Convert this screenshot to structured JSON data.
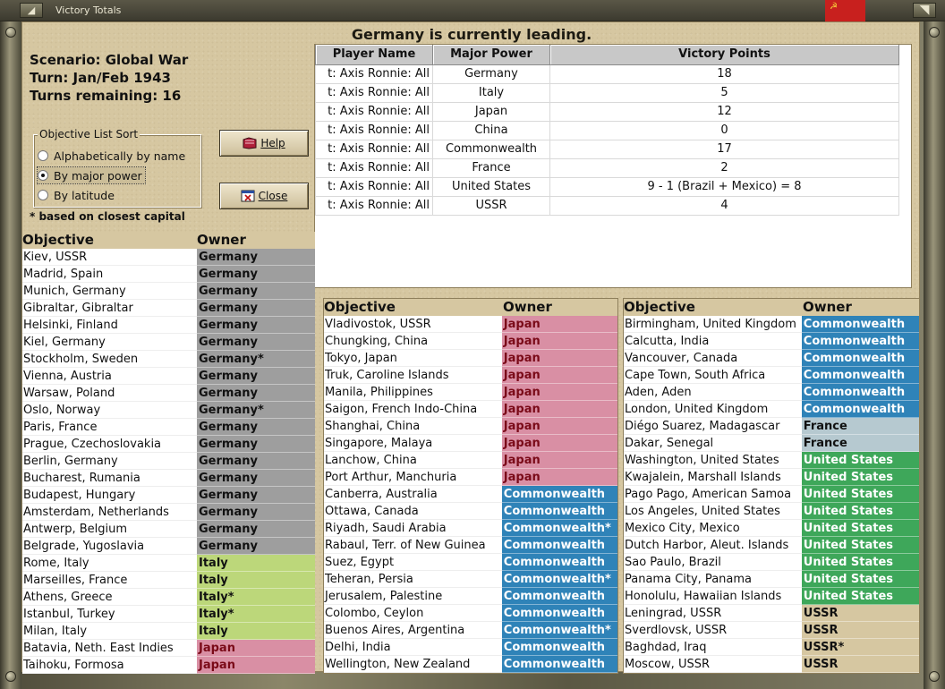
{
  "window": {
    "title": "Victory Totals"
  },
  "colors": {
    "germany": "#9e9e9e",
    "italy": "#bcd77a",
    "japan": "#d98fa4",
    "commonwealth": "#2f83b8",
    "france": "#b6c9d0",
    "united_states": "#3ea75a",
    "ussr": "#d6c7a1",
    "parchment": "#d6c7a1"
  },
  "banner": "Germany is currently leading.",
  "scenario": {
    "scenario_line": "Scenario: Global War",
    "turn_line": "Turn: Jan/Feb 1943",
    "remaining_line": "Turns remaining: 16"
  },
  "sort": {
    "legend": "Objective List Sort",
    "options": [
      "Alphabetically by name",
      "By major power",
      "By latitude"
    ],
    "selected_index": 1,
    "footnote": "* based on closest capital"
  },
  "buttons": {
    "help": "Help",
    "close": "Close"
  },
  "vp_table": {
    "headers": [
      "Player Name",
      "Major Power",
      "Victory Points"
    ],
    "rows": [
      {
        "player": "t: Axis    Ronnie: All",
        "power": "Germany",
        "points": "18"
      },
      {
        "player": "t: Axis    Ronnie: All",
        "power": "Italy",
        "points": "5"
      },
      {
        "player": "t: Axis    Ronnie: All",
        "power": "Japan",
        "points": "12"
      },
      {
        "player": "t: Axis    Ronnie: All",
        "power": "China",
        "points": "0"
      },
      {
        "player": "t: Axis    Ronnie: All",
        "power": "Commonwealth",
        "points": "17"
      },
      {
        "player": "t: Axis    Ronnie: All",
        "power": "France",
        "points": "2"
      },
      {
        "player": "t: Axis    Ronnie: All",
        "power": "United States",
        "points": "9 - 1 (Brazil + Mexico) = 8"
      },
      {
        "player": "t: Axis    Ronnie: All",
        "power": "USSR",
        "points": "4"
      }
    ]
  },
  "objective_headers": {
    "objective": "Objective",
    "owner": "Owner"
  },
  "lists": {
    "left": [
      {
        "name": "Kiev, USSR",
        "owner": "Germany",
        "power": "germany"
      },
      {
        "name": "Madrid, Spain",
        "owner": "Germany",
        "power": "germany"
      },
      {
        "name": "Munich, Germany",
        "owner": "Germany",
        "power": "germany"
      },
      {
        "name": "Gibraltar, Gibraltar",
        "owner": "Germany",
        "power": "germany"
      },
      {
        "name": "Helsinki, Finland",
        "owner": "Germany",
        "power": "germany"
      },
      {
        "name": "Kiel, Germany",
        "owner": "Germany",
        "power": "germany"
      },
      {
        "name": "Stockholm, Sweden",
        "owner": "Germany*",
        "power": "germany"
      },
      {
        "name": "Vienna, Austria",
        "owner": "Germany",
        "power": "germany"
      },
      {
        "name": "Warsaw, Poland",
        "owner": "Germany",
        "power": "germany"
      },
      {
        "name": "Oslo, Norway",
        "owner": "Germany*",
        "power": "germany"
      },
      {
        "name": "Paris, France",
        "owner": "Germany",
        "power": "germany"
      },
      {
        "name": "Prague, Czechoslovakia",
        "owner": "Germany",
        "power": "germany"
      },
      {
        "name": "Berlin, Germany",
        "owner": "Germany",
        "power": "germany"
      },
      {
        "name": "Bucharest, Rumania",
        "owner": "Germany",
        "power": "germany"
      },
      {
        "name": "Budapest, Hungary",
        "owner": "Germany",
        "power": "germany"
      },
      {
        "name": "Amsterdam, Netherlands",
        "owner": "Germany",
        "power": "germany"
      },
      {
        "name": "Antwerp, Belgium",
        "owner": "Germany",
        "power": "germany"
      },
      {
        "name": "Belgrade, Yugoslavia",
        "owner": "Germany",
        "power": "germany"
      },
      {
        "name": "Rome, Italy",
        "owner": "Italy",
        "power": "italy"
      },
      {
        "name": "Marseilles, France",
        "owner": "Italy",
        "power": "italy"
      },
      {
        "name": "Athens, Greece",
        "owner": "Italy*",
        "power": "italy"
      },
      {
        "name": "Istanbul, Turkey",
        "owner": "Italy*",
        "power": "italy"
      },
      {
        "name": "Milan, Italy",
        "owner": "Italy",
        "power": "italy"
      },
      {
        "name": "Batavia, Neth. East Indies",
        "owner": "Japan",
        "power": "japan"
      },
      {
        "name": "Taihoku, Formosa",
        "owner": "Japan",
        "power": "japan"
      }
    ],
    "middle": [
      {
        "name": "Vladivostok, USSR",
        "owner": "Japan",
        "power": "japan"
      },
      {
        "name": "Chungking, China",
        "owner": "Japan",
        "power": "japan"
      },
      {
        "name": "Tokyo, Japan",
        "owner": "Japan",
        "power": "japan"
      },
      {
        "name": "Truk, Caroline Islands",
        "owner": "Japan",
        "power": "japan"
      },
      {
        "name": "Manila, Philippines",
        "owner": "Japan",
        "power": "japan"
      },
      {
        "name": "Saigon, French Indo-China",
        "owner": "Japan",
        "power": "japan"
      },
      {
        "name": "Shanghai, China",
        "owner": "Japan",
        "power": "japan"
      },
      {
        "name": "Singapore, Malaya",
        "owner": "Japan",
        "power": "japan"
      },
      {
        "name": "Lanchow, China",
        "owner": "Japan",
        "power": "japan"
      },
      {
        "name": "Port Arthur, Manchuria",
        "owner": "Japan",
        "power": "japan"
      },
      {
        "name": "Canberra, Australia",
        "owner": "Commonwealth",
        "power": "commonwealth"
      },
      {
        "name": "Ottawa, Canada",
        "owner": "Commonwealth",
        "power": "commonwealth"
      },
      {
        "name": "Riyadh, Saudi Arabia",
        "owner": "Commonwealth*",
        "power": "commonwealth"
      },
      {
        "name": "Rabaul, Terr. of New Guinea",
        "owner": "Commonwealth",
        "power": "commonwealth"
      },
      {
        "name": "Suez, Egypt",
        "owner": "Commonwealth",
        "power": "commonwealth"
      },
      {
        "name": "Teheran, Persia",
        "owner": "Commonwealth*",
        "power": "commonwealth"
      },
      {
        "name": "Jerusalem, Palestine",
        "owner": "Commonwealth",
        "power": "commonwealth"
      },
      {
        "name": "Colombo, Ceylon",
        "owner": "Commonwealth",
        "power": "commonwealth"
      },
      {
        "name": "Buenos Aires, Argentina",
        "owner": "Commonwealth*",
        "power": "commonwealth"
      },
      {
        "name": "Delhi, India",
        "owner": "Commonwealth",
        "power": "commonwealth"
      },
      {
        "name": "Wellington, New Zealand",
        "owner": "Commonwealth",
        "power": "commonwealth"
      }
    ],
    "right": [
      {
        "name": "Birmingham, United Kingdom",
        "owner": "Commonwealth",
        "power": "commonwealth"
      },
      {
        "name": "Calcutta, India",
        "owner": "Commonwealth",
        "power": "commonwealth"
      },
      {
        "name": "Vancouver, Canada",
        "owner": "Commonwealth",
        "power": "commonwealth"
      },
      {
        "name": "Cape Town, South Africa",
        "owner": "Commonwealth",
        "power": "commonwealth"
      },
      {
        "name": "Aden, Aden",
        "owner": "Commonwealth",
        "power": "commonwealth"
      },
      {
        "name": "London, United Kingdom",
        "owner": "Commonwealth",
        "power": "commonwealth"
      },
      {
        "name": "Diégo Suarez, Madagascar",
        "owner": "France",
        "power": "france"
      },
      {
        "name": "Dakar, Senegal",
        "owner": "France",
        "power": "france"
      },
      {
        "name": "Washington, United States",
        "owner": "United States",
        "power": "united-states"
      },
      {
        "name": "Kwajalein, Marshall Islands",
        "owner": "United States",
        "power": "united-states"
      },
      {
        "name": "Pago Pago, American Samoa",
        "owner": "United States",
        "power": "united-states"
      },
      {
        "name": "Los Angeles, United States",
        "owner": "United States",
        "power": "united-states"
      },
      {
        "name": "Mexico City, Mexico",
        "owner": "United States",
        "power": "united-states"
      },
      {
        "name": "Dutch Harbor, Aleut. Islands",
        "owner": "United States",
        "power": "united-states"
      },
      {
        "name": "Sao Paulo, Brazil",
        "owner": "United States",
        "power": "united-states"
      },
      {
        "name": "Panama City, Panama",
        "owner": "United States",
        "power": "united-states"
      },
      {
        "name": "Honolulu, Hawaiian Islands",
        "owner": "United States",
        "power": "united-states"
      },
      {
        "name": "Leningrad, USSR",
        "owner": "USSR",
        "power": "ussr"
      },
      {
        "name": "Sverdlovsk, USSR",
        "owner": "USSR",
        "power": "ussr"
      },
      {
        "name": "Baghdad, Iraq",
        "owner": "USSR*",
        "power": "ussr"
      },
      {
        "name": "Moscow, USSR",
        "owner": "USSR",
        "power": "ussr"
      }
    ]
  }
}
